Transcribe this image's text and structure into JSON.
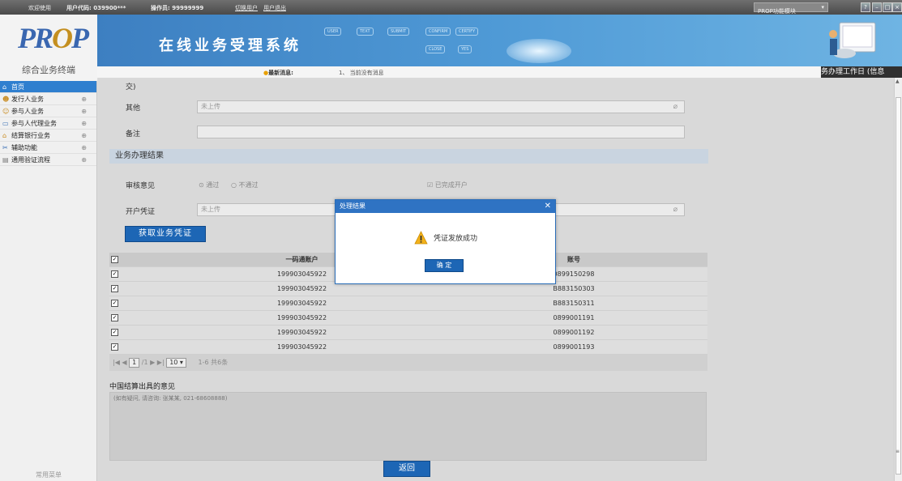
{
  "topbar": {
    "welcome": "欢迎使用",
    "user_code": "用户代码: 039900***",
    "operator": "操作员: 99999999",
    "switch_user": "切换用户",
    "logout": "用户退出",
    "module_select": "PROP功能模块"
  },
  "logo": {
    "text": "PROP",
    "subtitle": "综合业务终端"
  },
  "banner": {
    "title": "在线业务受理系统",
    "flow": [
      "USER",
      "TEXT",
      "SUBMIT",
      "CONFIRM",
      "CERTIFY",
      "CLOSE",
      "YES"
    ]
  },
  "news": {
    "label": "最新消息:",
    "message": "1、 当前没有消息",
    "marquee": "务办理工作日 (信息"
  },
  "sidebar": {
    "items": [
      {
        "label": "首页",
        "icon": "home-icon",
        "active": true
      },
      {
        "label": "发行人业务",
        "icon": "person-icon"
      },
      {
        "label": "参与人业务",
        "icon": "people-icon"
      },
      {
        "label": "参与人代理业务",
        "icon": "monitor-icon"
      },
      {
        "label": "结算银行业务",
        "icon": "bank-icon"
      },
      {
        "label": "辅助功能",
        "icon": "tool-icon"
      },
      {
        "label": "通用验证流程",
        "icon": "folder-icon"
      }
    ],
    "footer": "常用菜单"
  },
  "form": {
    "paren_text": "交)",
    "other_label": "其他",
    "other_value": "未上传",
    "remark_label": "备注",
    "remark_value": "",
    "section_title": "业务办理结果",
    "review_label": "审核意见",
    "pass": "通过",
    "fail": "不通过",
    "opened": "已完成开户",
    "voucher_label": "开户凭证",
    "voucher_value": "未上传",
    "get_voucher": "获取业务凭证"
  },
  "table": {
    "headers": [
      "一码通账户",
      "账号"
    ],
    "rows": [
      [
        "199903045922",
        "0899150298"
      ],
      [
        "199903045922",
        "B883150303"
      ],
      [
        "199903045922",
        "B883150311"
      ],
      [
        "199903045922",
        "0899001191"
      ],
      [
        "199903045922",
        "0899001192"
      ],
      [
        "199903045922",
        "0899001193"
      ]
    ]
  },
  "pager": {
    "page": "1",
    "total": "/1",
    "size": "10",
    "info": "1-6 共6条"
  },
  "opinion": {
    "title": "中国结算出具的意见",
    "hint": "(如有疑问, 请咨询: 张某某, 021-68608888)"
  },
  "back_button": "返回",
  "dialog": {
    "title": "处理结果",
    "message": "凭证发放成功",
    "ok": "确 定"
  }
}
